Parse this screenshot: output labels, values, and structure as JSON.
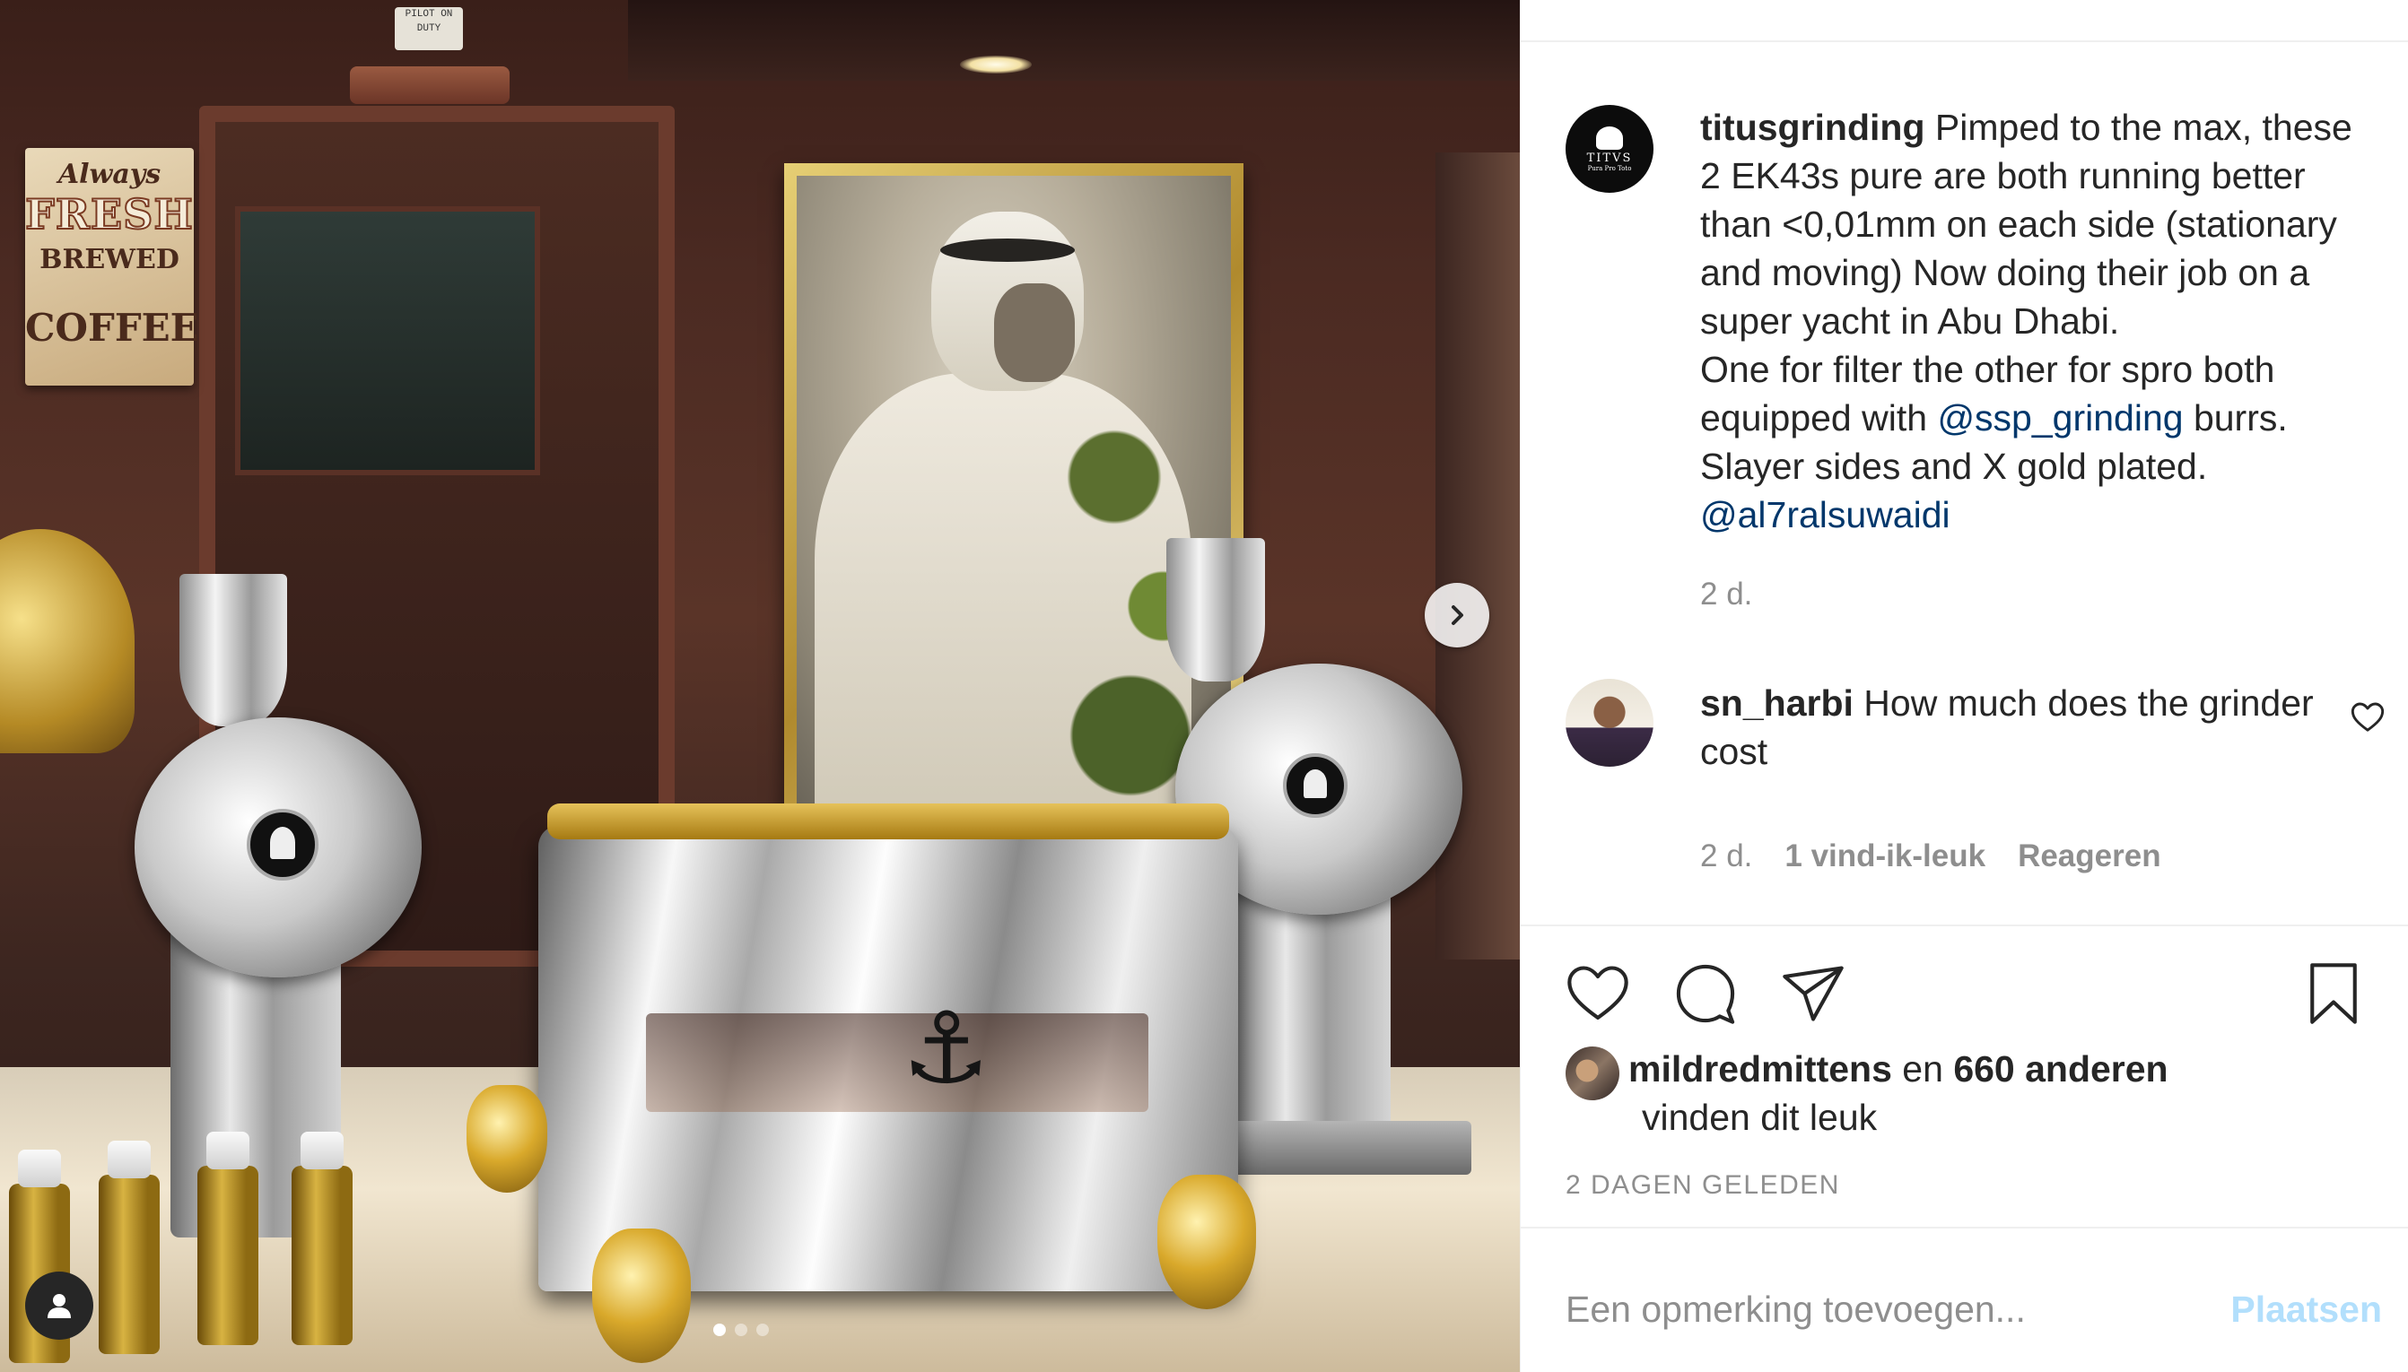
{
  "photo": {
    "sign": {
      "line1": "Always",
      "line2": "FRESH",
      "line3": "BREWED",
      "line4": "COFFEE"
    },
    "placard": "PILOT ON DUTY",
    "carousel": {
      "dot_count": 3,
      "active_index": 0
    }
  },
  "post": {
    "author": "titusgrinding",
    "caption_part1": "Pimped to the max, these 2 EK43s pure are both running better than <0,01mm on each side (stationary and moving) Now doing their job on a super yacht in Abu Dhabi.",
    "caption_part2": "One for filter the other for spro both equipped with",
    "mention1": "@ssp_grinding",
    "caption_part3": "burrs. Slayer sides and X gold plated.",
    "mention2": "@al7ralsuwaidi",
    "caption_time": "2 d."
  },
  "comments": [
    {
      "user": "sn_harbi",
      "text": "How much does the grinder cost",
      "time": "2 d.",
      "likes": "1 vind-ik-leuk",
      "reply": "Reageren"
    }
  ],
  "likes": {
    "user": "mildredmittens",
    "connector": "en",
    "others": "660 anderen",
    "suffix": "vinden dit leuk"
  },
  "post_date": "2 DAGEN GELEDEN",
  "comment_box": {
    "placeholder": "Een opmerking toevoegen...",
    "submit_label": "Plaatsen"
  },
  "icons": {
    "like": "heart-icon",
    "comment": "comment-bubble-icon",
    "share": "paper-plane-icon",
    "save": "bookmark-icon",
    "next": "chevron-right-icon",
    "tag": "user-tag-icon"
  },
  "colors": {
    "mention": "#00376b",
    "muted": "#8e8e8e",
    "post_button_disabled": "#b2dffc",
    "text": "#262626"
  }
}
